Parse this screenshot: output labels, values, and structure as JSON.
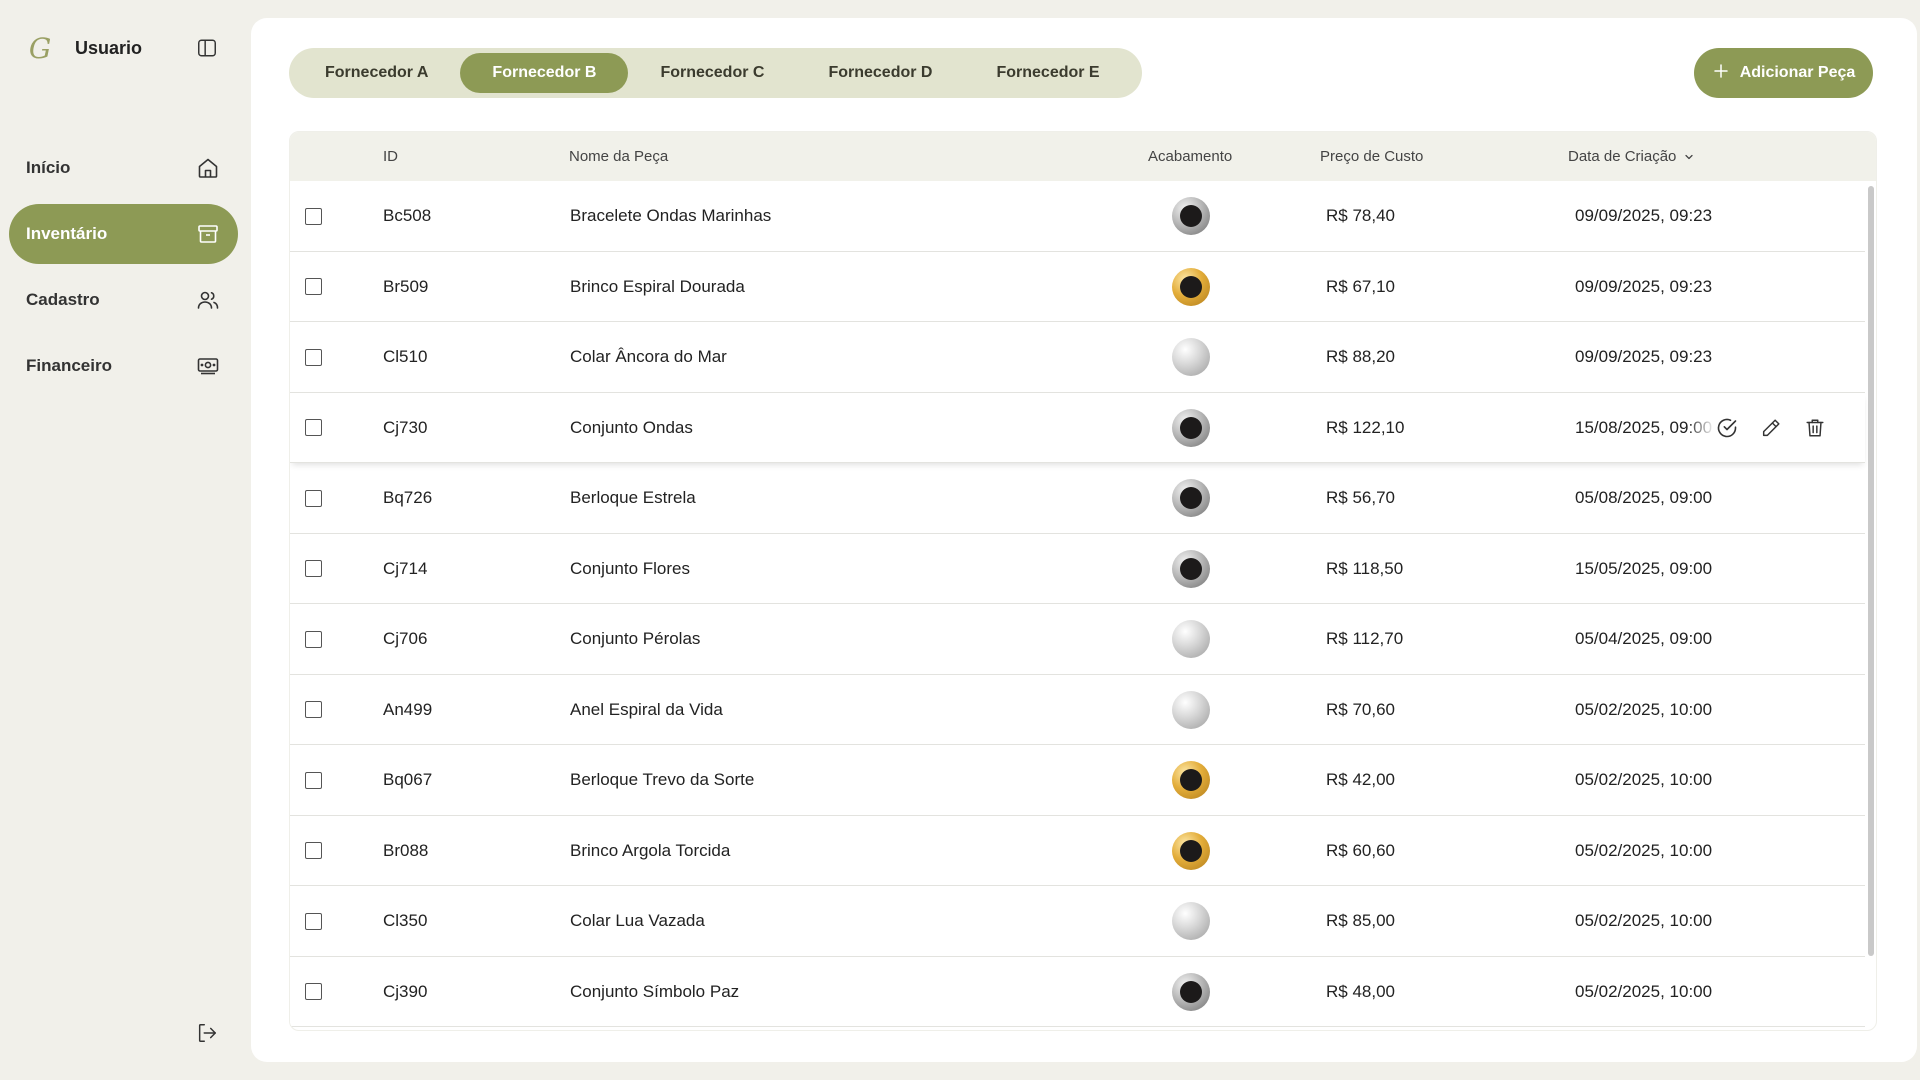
{
  "sidebar": {
    "brand_logo": "G",
    "user_name": "Usuario",
    "panel_toggle_icon": "panel-left-icon",
    "items": [
      {
        "label": "Início",
        "icon": "home-icon",
        "active": false
      },
      {
        "label": "Inventário",
        "icon": "archive-icon",
        "active": true
      },
      {
        "label": "Cadastro",
        "icon": "users-icon",
        "active": false
      },
      {
        "label": "Financeiro",
        "icon": "banknote-icon",
        "active": false
      }
    ],
    "logout_icon": "logout-icon"
  },
  "tabs": [
    {
      "label": "Fornecedor A",
      "active": false
    },
    {
      "label": "Fornecedor B",
      "active": true
    },
    {
      "label": "Fornecedor C",
      "active": false
    },
    {
      "label": "Fornecedor D",
      "active": false
    },
    {
      "label": "Fornecedor E",
      "active": false
    }
  ],
  "add_button": {
    "label": "Adicionar Peça",
    "icon": "plus-icon"
  },
  "table": {
    "columns": {
      "id": "ID",
      "name": "Nome da Peça",
      "finish": "Acabamento",
      "cost": "Preço de Custo",
      "created": "Data de Criação"
    },
    "sort_icon": "chevron-down-icon",
    "rows": [
      {
        "id": "Bc508",
        "name": "Bracelete Ondas Marinhas",
        "finish": "black",
        "cost": "R$ 78,40",
        "created": "09/09/2025, 09:23"
      },
      {
        "id": "Br509",
        "name": "Brinco Espiral Dourada",
        "finish": "gold",
        "cost": "R$ 67,10",
        "created": "09/09/2025, 09:23"
      },
      {
        "id": "Cl510",
        "name": "Colar Âncora do Mar",
        "finish": "silver",
        "cost": "R$ 88,20",
        "created": "09/09/2025, 09:23"
      },
      {
        "id": "Cj730",
        "name": "Conjunto Ondas",
        "finish": "black",
        "cost": "R$ 122,10",
        "created": "15/08/2025, 09:00",
        "hovered": true
      },
      {
        "id": "Bq726",
        "name": "Berloque Estrela",
        "finish": "black",
        "cost": "R$ 56,70",
        "created": "05/08/2025, 09:00"
      },
      {
        "id": "Cj714",
        "name": "Conjunto Flores",
        "finish": "black",
        "cost": "R$ 118,50",
        "created": "15/05/2025, 09:00"
      },
      {
        "id": "Cj706",
        "name": "Conjunto Pérolas",
        "finish": "silver",
        "cost": "R$ 112,70",
        "created": "05/04/2025, 09:00"
      },
      {
        "id": "An499",
        "name": "Anel Espiral da Vida",
        "finish": "silver",
        "cost": "R$ 70,60",
        "created": "05/02/2025, 10:00"
      },
      {
        "id": "Bq067",
        "name": "Berloque Trevo da Sorte",
        "finish": "gold",
        "cost": "R$ 42,00",
        "created": "05/02/2025, 10:00"
      },
      {
        "id": "Br088",
        "name": "Brinco Argola Torcida",
        "finish": "gold",
        "cost": "R$ 60,60",
        "created": "05/02/2025, 10:00"
      },
      {
        "id": "Cl350",
        "name": "Colar Lua Vazada",
        "finish": "silver",
        "cost": "R$ 85,00",
        "created": "05/02/2025, 10:00"
      },
      {
        "id": "Cj390",
        "name": "Conjunto Símbolo Paz",
        "finish": "black",
        "cost": "R$ 48,00",
        "created": "05/02/2025, 10:00"
      }
    ],
    "row_actions": [
      "check-circle-icon",
      "pencil-icon",
      "trash-icon"
    ]
  }
}
